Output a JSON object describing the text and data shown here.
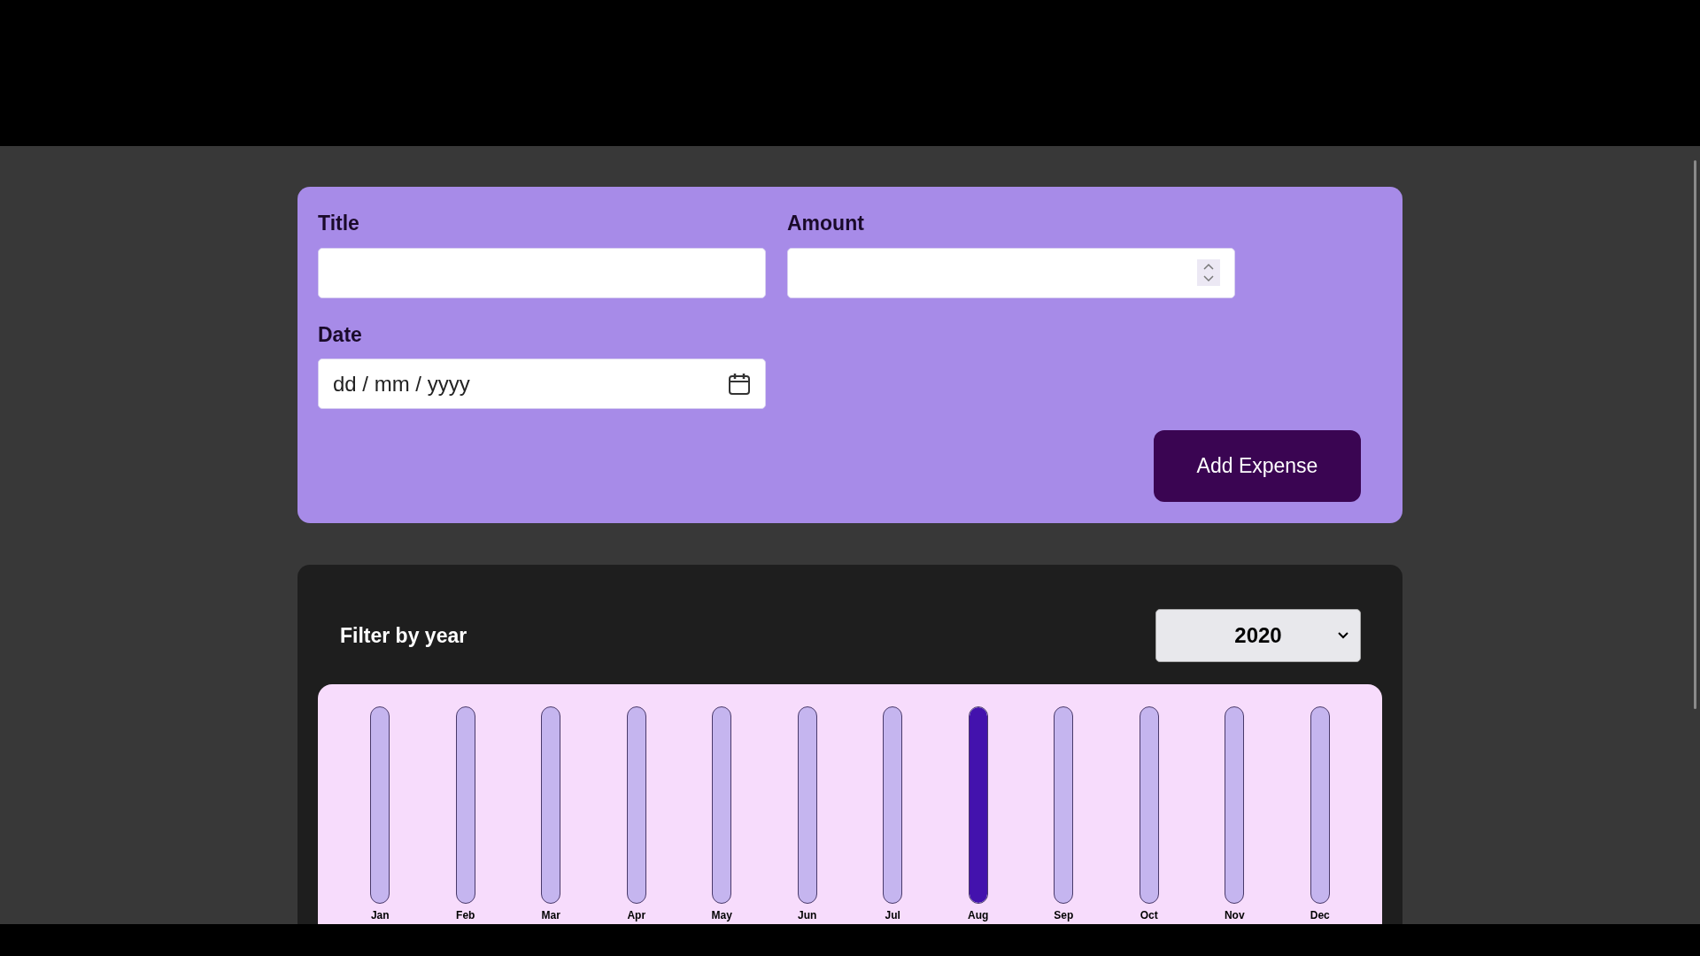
{
  "expense_form": {
    "fields": [
      {
        "label": "Title",
        "kind": "text"
      },
      {
        "label": "Amount",
        "kind": "number"
      },
      {
        "label": "Date",
        "kind": "date",
        "placeholder": "dd / mm / yyyy"
      }
    ],
    "submit_button": "Add Expense"
  },
  "filter": {
    "label": "Filter by year",
    "selected_year": "2020"
  },
  "chart": {
    "months": [
      {
        "label": "Jan",
        "level": 0
      },
      {
        "label": "Feb",
        "level": 0
      },
      {
        "label": "Mar",
        "level": 0
      },
      {
        "label": "Apr",
        "level": 0
      },
      {
        "label": "May",
        "level": 0
      },
      {
        "label": "Jun",
        "level": 0
      },
      {
        "label": "Jul",
        "level": 0
      },
      {
        "label": "Aug",
        "level": 1
      },
      {
        "label": "Sep",
        "level": 0
      },
      {
        "label": "Oct",
        "level": 0
      },
      {
        "label": "Nov",
        "level": 0
      },
      {
        "label": "Dec",
        "level": 0
      }
    ]
  }
}
